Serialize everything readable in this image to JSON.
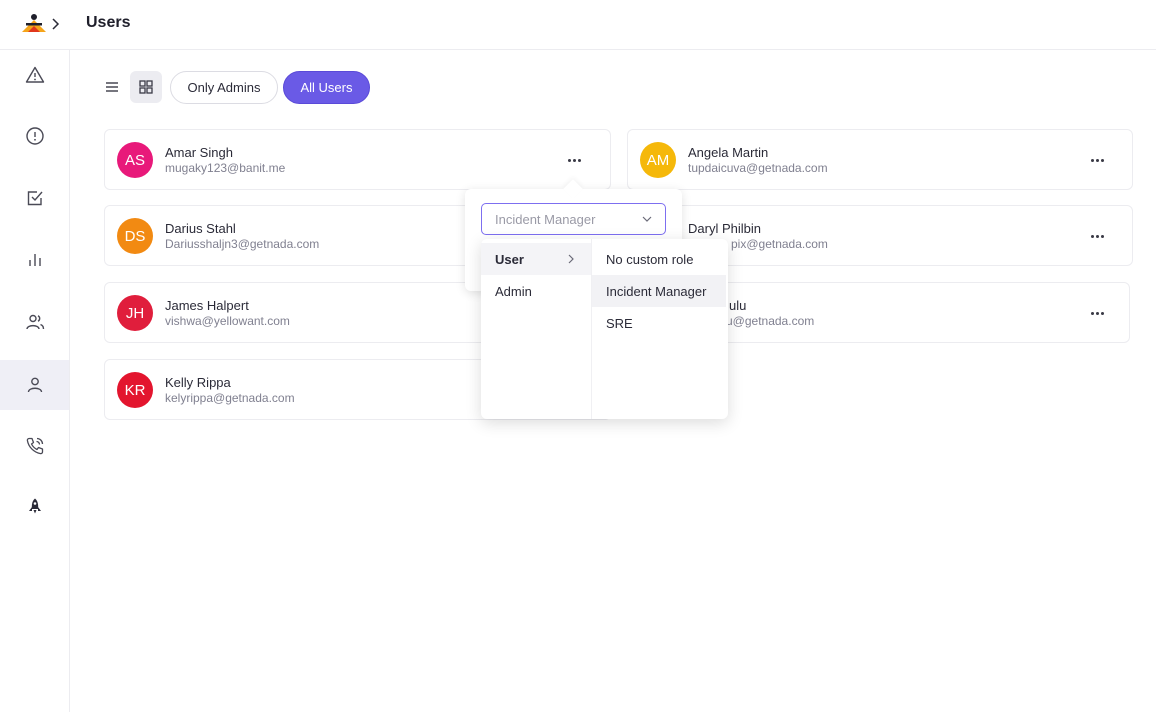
{
  "header": {
    "title": "Users"
  },
  "sidebar": {
    "items": [
      {
        "icon": "alert-triangle-icon"
      },
      {
        "icon": "alert-circle-icon"
      },
      {
        "icon": "checkbox-icon"
      },
      {
        "icon": "bar-chart-icon"
      },
      {
        "icon": "users-icon"
      },
      {
        "icon": "user-icon",
        "active": true
      },
      {
        "icon": "phone-icon"
      },
      {
        "icon": "rocket-icon"
      }
    ]
  },
  "toolbar": {
    "list_view_icon": "list-icon",
    "grid_view_icon": "grid-icon",
    "filter_only_admins": "Only Admins",
    "filter_all_users": "All Users"
  },
  "users": [
    {
      "initials": "AS",
      "name": "Amar Singh",
      "email": "mugaky123@banit.me",
      "color": "#e8197a"
    },
    {
      "initials": "AM",
      "name": "Angela Martin",
      "email": "tupdaicuva@getnada.com",
      "color": "#f5b80a"
    },
    {
      "initials": "DS",
      "name": "Darius Stahl",
      "email": "Dariusshaljn3@getnada.com",
      "color": "#f28a12"
    },
    {
      "initials": "",
      "name": "Daryl Philbin",
      "email": "pix@getnada.com",
      "color": "#ffffff"
    },
    {
      "initials": "JH",
      "name": "James Halpert",
      "email": "vishwa@yellowant.com",
      "color": "#e01e3c"
    },
    {
      "initials": "",
      "name": "ulu",
      "email": "u@getnada.com",
      "color": "#ffffff"
    },
    {
      "initials": "KR",
      "name": "Kelly Rippa",
      "email": "kelyrippa@getnada.com",
      "color": "#e3152e"
    }
  ],
  "role_select": {
    "value": "Incident Manager",
    "level1": [
      {
        "label": "User",
        "expanded": true
      },
      {
        "label": "Admin"
      }
    ],
    "level2": [
      {
        "label": "No custom role"
      },
      {
        "label": "Incident Manager",
        "selected": true
      },
      {
        "label": "SRE"
      }
    ]
  }
}
